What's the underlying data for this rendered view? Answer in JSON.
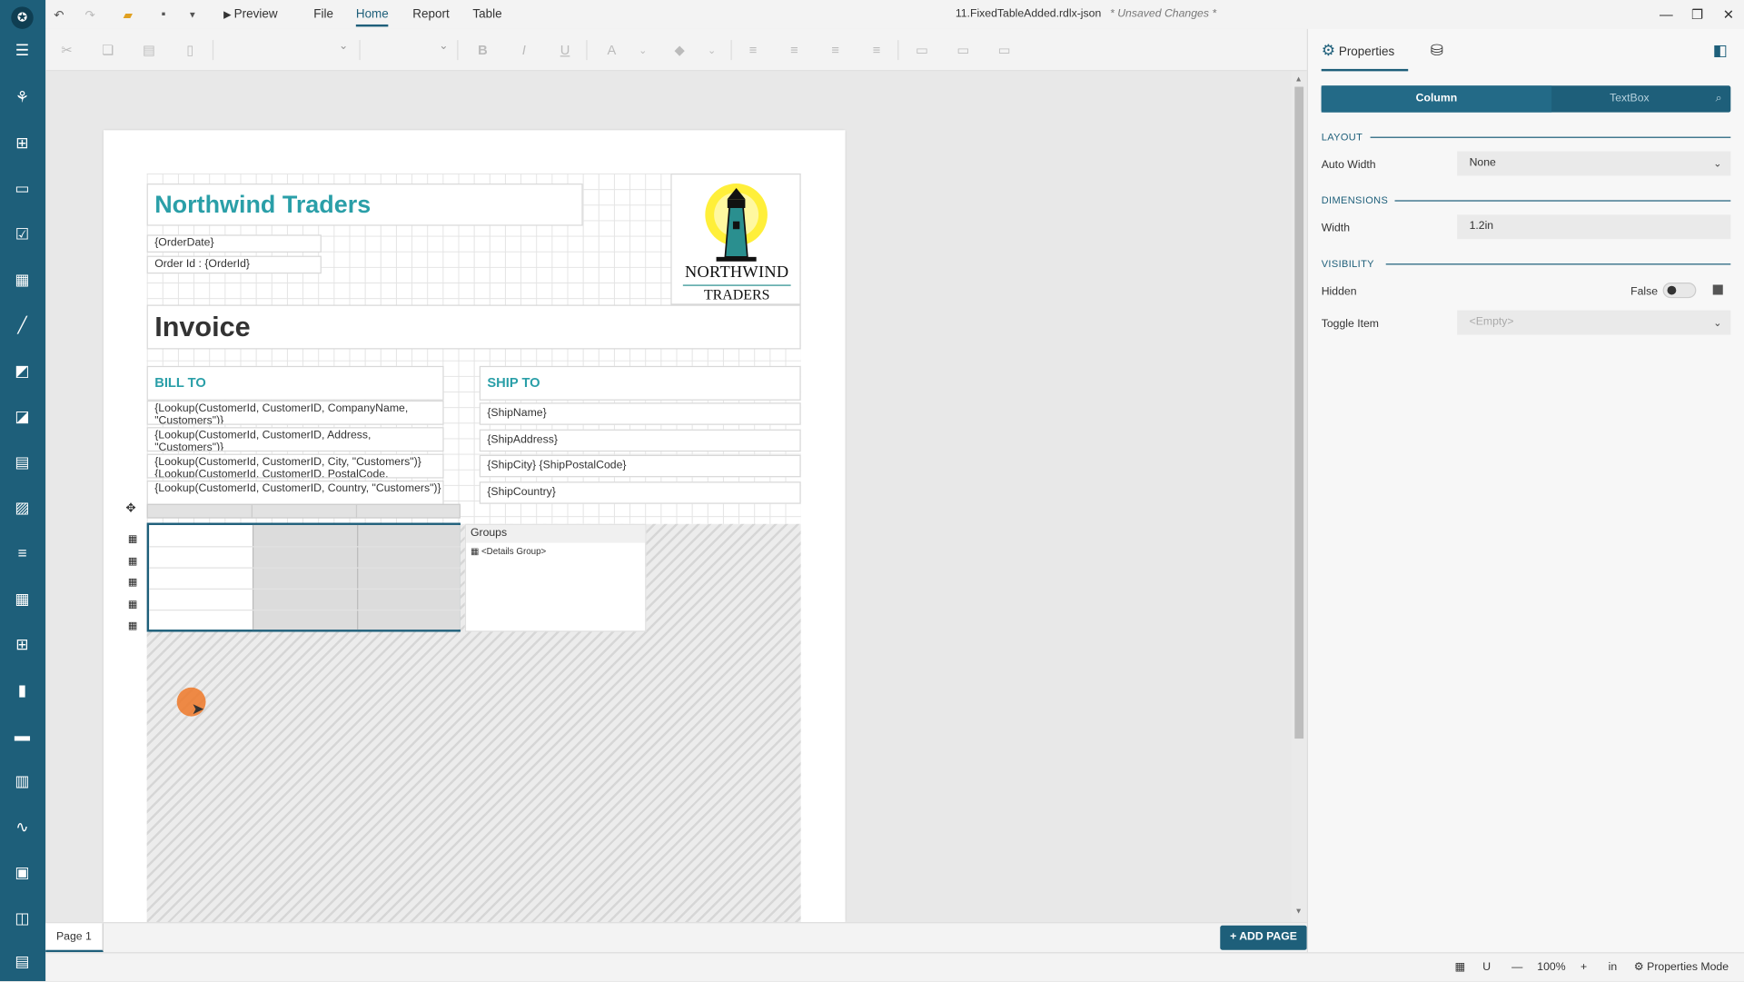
{
  "titlebar": {
    "preview": "Preview",
    "menu": [
      "File",
      "Home",
      "Report",
      "Table"
    ],
    "active_menu": "Home",
    "document": "11.FixedTableAdded.rdlx-json",
    "unsaved": "* Unsaved Changes *"
  },
  "report": {
    "company": "Northwind Traders",
    "order_date": "{OrderDate}",
    "order_id": "Order Id : {OrderId}",
    "logo_line1": "NORTHWIND",
    "logo_line2": "TRADERS",
    "invoice": "Invoice",
    "bill_to": "BILL TO",
    "ship_to": "SHIP TO",
    "bill_lines": [
      "{Lookup(CustomerId, CustomerID, CompanyName, \"Customers\")}",
      "{Lookup(CustomerId, CustomerID, Address, \"Customers\")}",
      "{Lookup(CustomerId, CustomerID, City, \"Customers\")} {Lookup(CustomerId, CustomerID, PostalCode, \"Customers\")}",
      "{Lookup(CustomerId, CustomerID, Country, \"Customers\")}"
    ],
    "ship_lines": [
      "{ShipName}",
      "{ShipAddress}",
      "{ShipCity} {ShipPostalCode}",
      "{ShipCountry}"
    ],
    "groups_title": "Groups",
    "details_group": "<Details Group>"
  },
  "pagebar": {
    "page_tab": "Page 1",
    "add_page": "ADD PAGE"
  },
  "statusbar": {
    "zoom": "100%",
    "unit": "in",
    "mode": "Properties Mode"
  },
  "panel": {
    "tab_properties": "Properties",
    "seg_column": "Column",
    "seg_textbox": "TextBox",
    "layout": "LAYOUT",
    "auto_width_label": "Auto Width",
    "auto_width_value": "None",
    "dimensions": "DIMENSIONS",
    "width_label": "Width",
    "width_value": "1.2in",
    "visibility": "VISIBILITY",
    "hidden_label": "Hidden",
    "hidden_value": "False",
    "toggle_item_label": "Toggle Item",
    "toggle_item_value": "<Empty>"
  },
  "colors": {
    "accent": "#1e5f7a",
    "teal_text": "#2a9fa8",
    "cursor": "#ee7828"
  }
}
